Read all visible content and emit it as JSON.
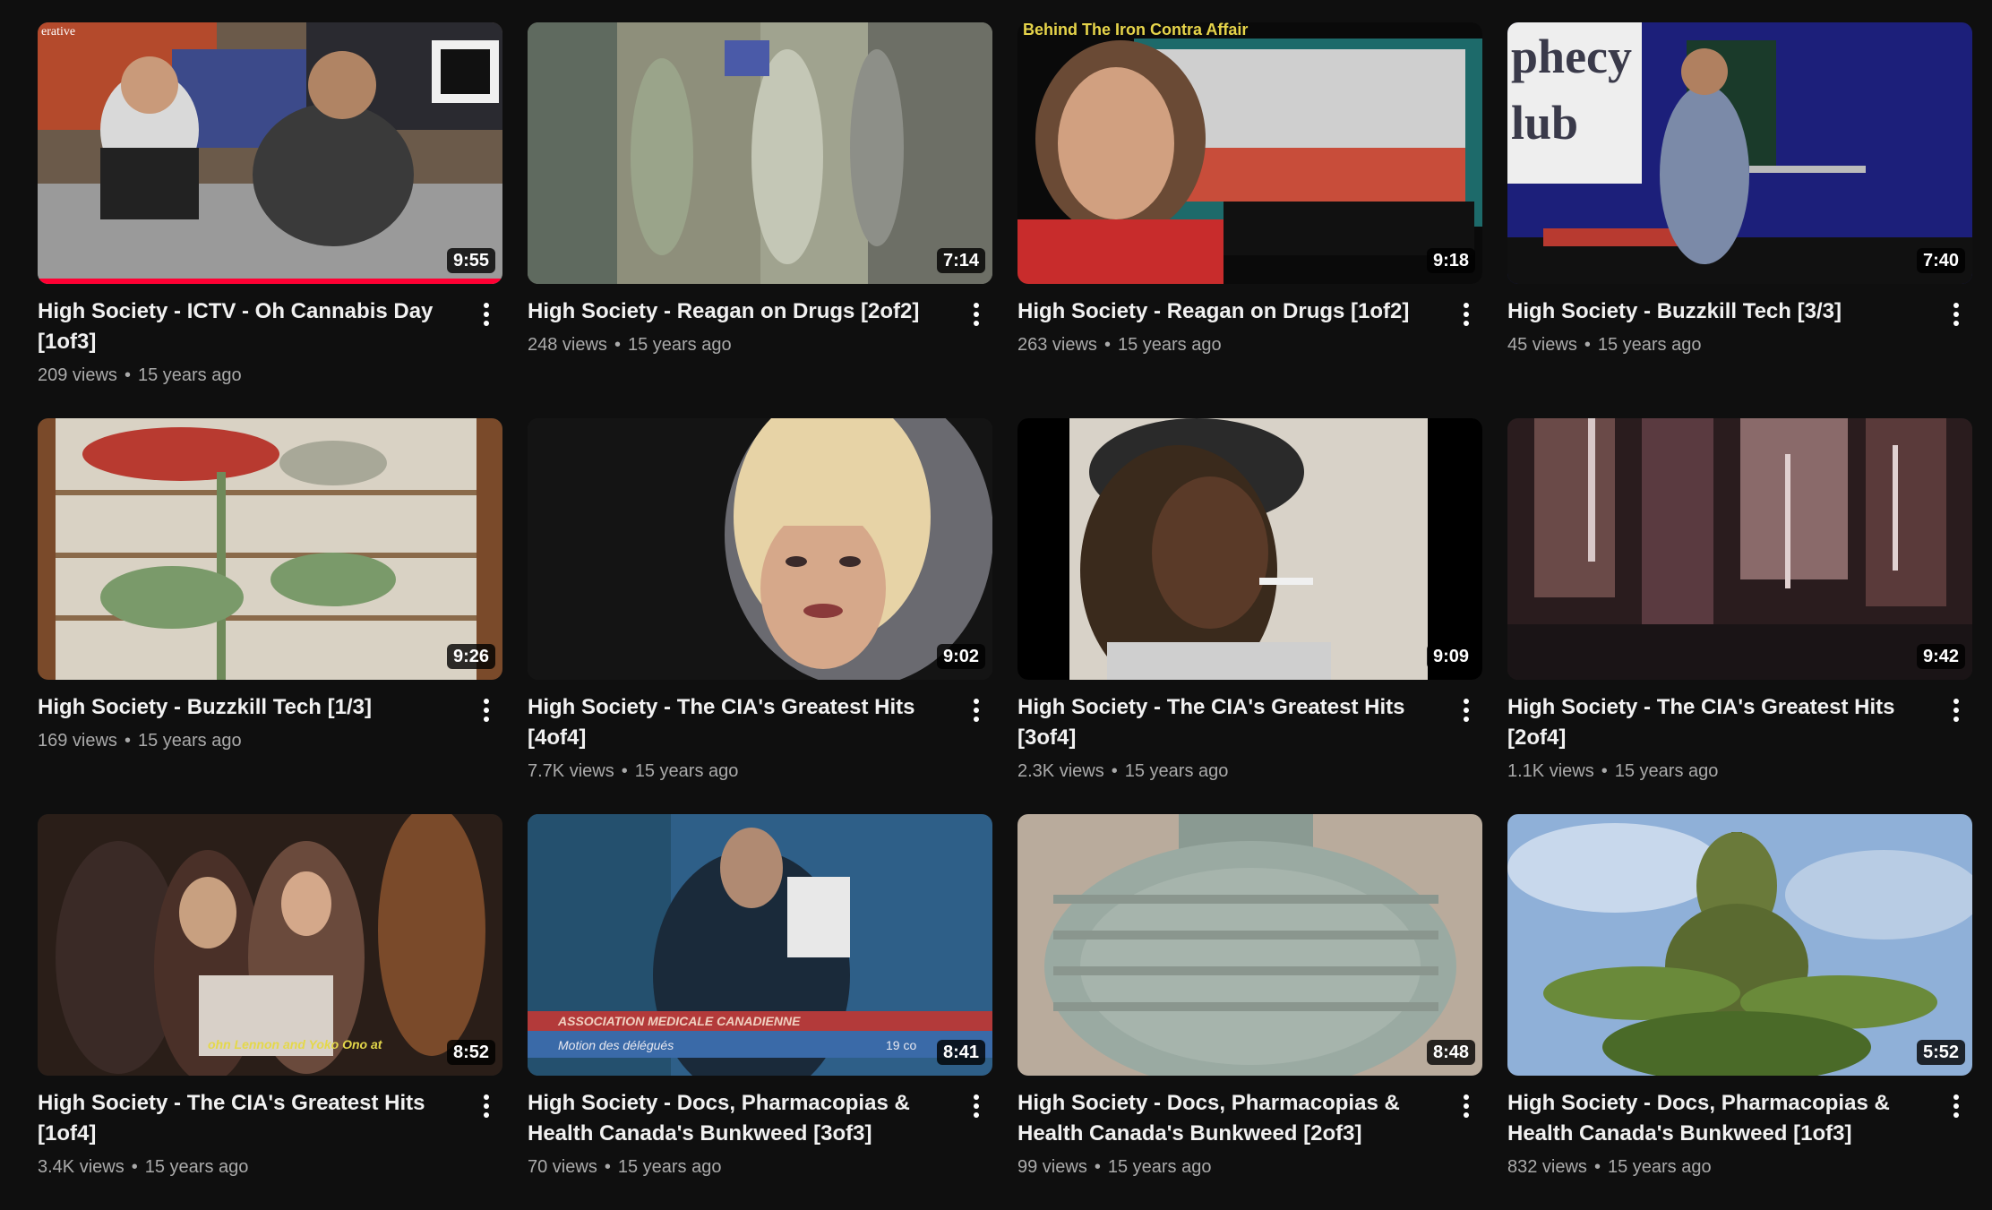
{
  "videos": [
    {
      "title": "High Society - ICTV - Oh Cannabis Day [1of3]",
      "duration": "9:55",
      "views": "209 views",
      "age": "15 years ago",
      "watched": 1.0
    },
    {
      "title": "High Society - Reagan on Drugs [2of2]",
      "duration": "7:14",
      "views": "248 views",
      "age": "15 years ago"
    },
    {
      "title": "High Society - Reagan on Drugs [1of2]",
      "duration": "9:18",
      "views": "263 views",
      "age": "15 years ago"
    },
    {
      "title": "High Society - Buzzkill Tech [3/3]",
      "duration": "7:40",
      "views": "45 views",
      "age": "15 years ago"
    },
    {
      "title": "High Society - Buzzkill Tech [1/3]",
      "duration": "9:26",
      "views": "169 views",
      "age": "15 years ago"
    },
    {
      "title": "High Society - The CIA's Greatest Hits [4of4]",
      "duration": "9:02",
      "views": "7.7K views",
      "age": "15 years ago"
    },
    {
      "title": "High Society - The CIA's Greatest Hits [3of4]",
      "duration": "9:09",
      "views": "2.3K views",
      "age": "15 years ago"
    },
    {
      "title": "High Society - The CIA's Greatest Hits [2of4]",
      "duration": "9:42",
      "views": "1.1K views",
      "age": "15 years ago"
    },
    {
      "title": "High Society - The CIA's Greatest Hits [1of4]",
      "duration": "8:52",
      "views": "3.4K views",
      "age": "15 years ago"
    },
    {
      "title": "High Society - Docs, Pharmacopias & Health Canada's Bunkweed [3of3]",
      "duration": "8:41",
      "views": "70 views",
      "age": "15 years ago"
    },
    {
      "title": "High Society - Docs, Pharmacopias & Health Canada's Bunkweed [2of3]",
      "duration": "8:48",
      "views": "99 views",
      "age": "15 years ago"
    },
    {
      "title": "High Society - Docs, Pharmacopias & Health Canada's Bunkweed [1of3]",
      "duration": "5:52",
      "views": "832 views",
      "age": "15 years ago"
    }
  ],
  "thumb_text": {
    "t1": "erative",
    "t3": "Behind The Iron Contra Affair",
    "t4a": "phecy",
    "t4b": "lub",
    "t9": "ohn Lennon and Yoko Ono at",
    "t10a": "ASSOCIATION MEDICALE CANADIENNE",
    "t10b": "Motion des délégués",
    "t10c": "19 co"
  },
  "colors": {
    "background": "#0f0f0f",
    "progress": "#ff0033",
    "title": "#f1f1f1",
    "meta": "#aaaaaa"
  },
  "icons": {
    "menu": "more-vert-icon"
  }
}
